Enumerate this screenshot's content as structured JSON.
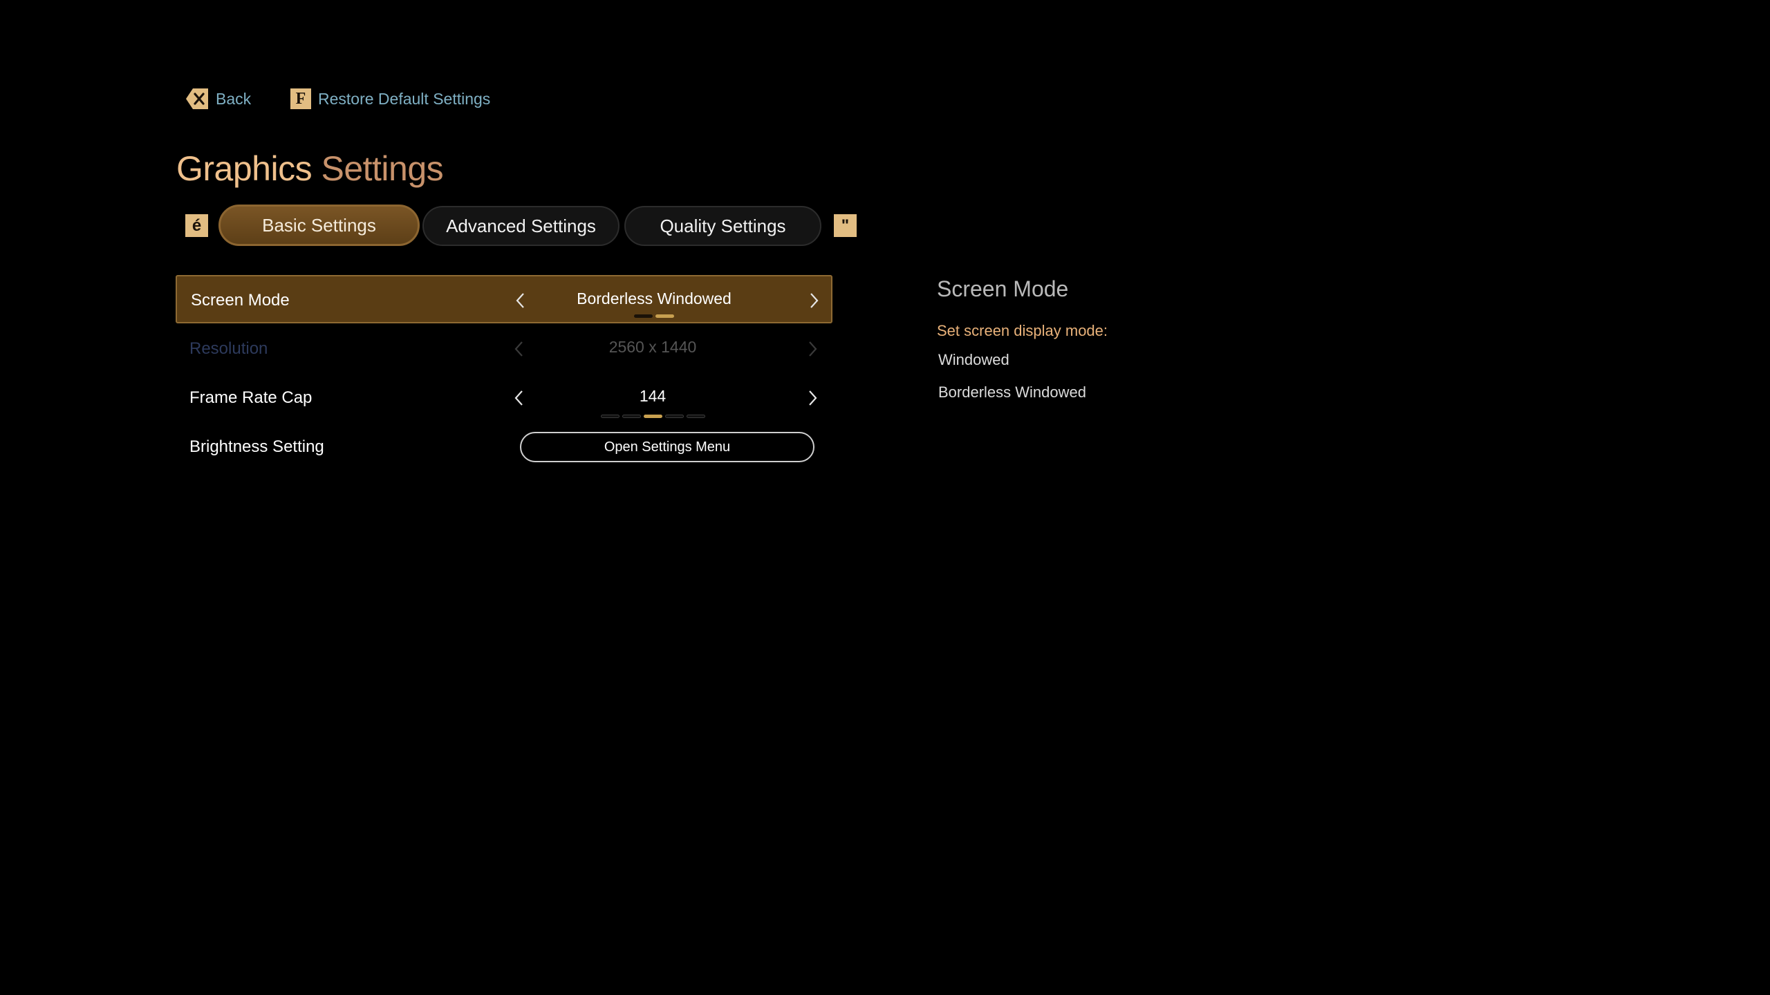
{
  "nav": {
    "back_label": "Back",
    "back_key": "back-key-icon",
    "restore_label": "Restore Default Settings",
    "restore_key": "F"
  },
  "title": {
    "part1": "Graphics",
    "part2": "Settings"
  },
  "tabs": {
    "prev_key": "é",
    "next_key": "\"",
    "items": [
      {
        "label": "Basic Settings",
        "active": true
      },
      {
        "label": "Advanced Settings",
        "active": false
      },
      {
        "label": "Quality Settings",
        "active": false
      }
    ]
  },
  "settings": {
    "screen_mode": {
      "label": "Screen Mode",
      "value": "Borderless Windowed",
      "option_count": 2,
      "selected_index": 1
    },
    "resolution": {
      "label": "Resolution",
      "value": "2560 x 1440",
      "disabled": true
    },
    "frame_rate_cap": {
      "label": "Frame Rate Cap",
      "value": "144",
      "option_count": 5,
      "selected_index": 2
    },
    "brightness": {
      "label": "Brightness Setting",
      "button_label": "Open Settings Menu"
    }
  },
  "info_panel": {
    "title": "Screen Mode",
    "description": "Set screen display mode:",
    "options": [
      "Windowed",
      "Borderless Windowed"
    ]
  },
  "colors": {
    "accent_gold": "#e2bd82",
    "selected_row": "#5a3d14",
    "nav_text": "#7fb0c4",
    "desc_text": "#e9b27a"
  }
}
